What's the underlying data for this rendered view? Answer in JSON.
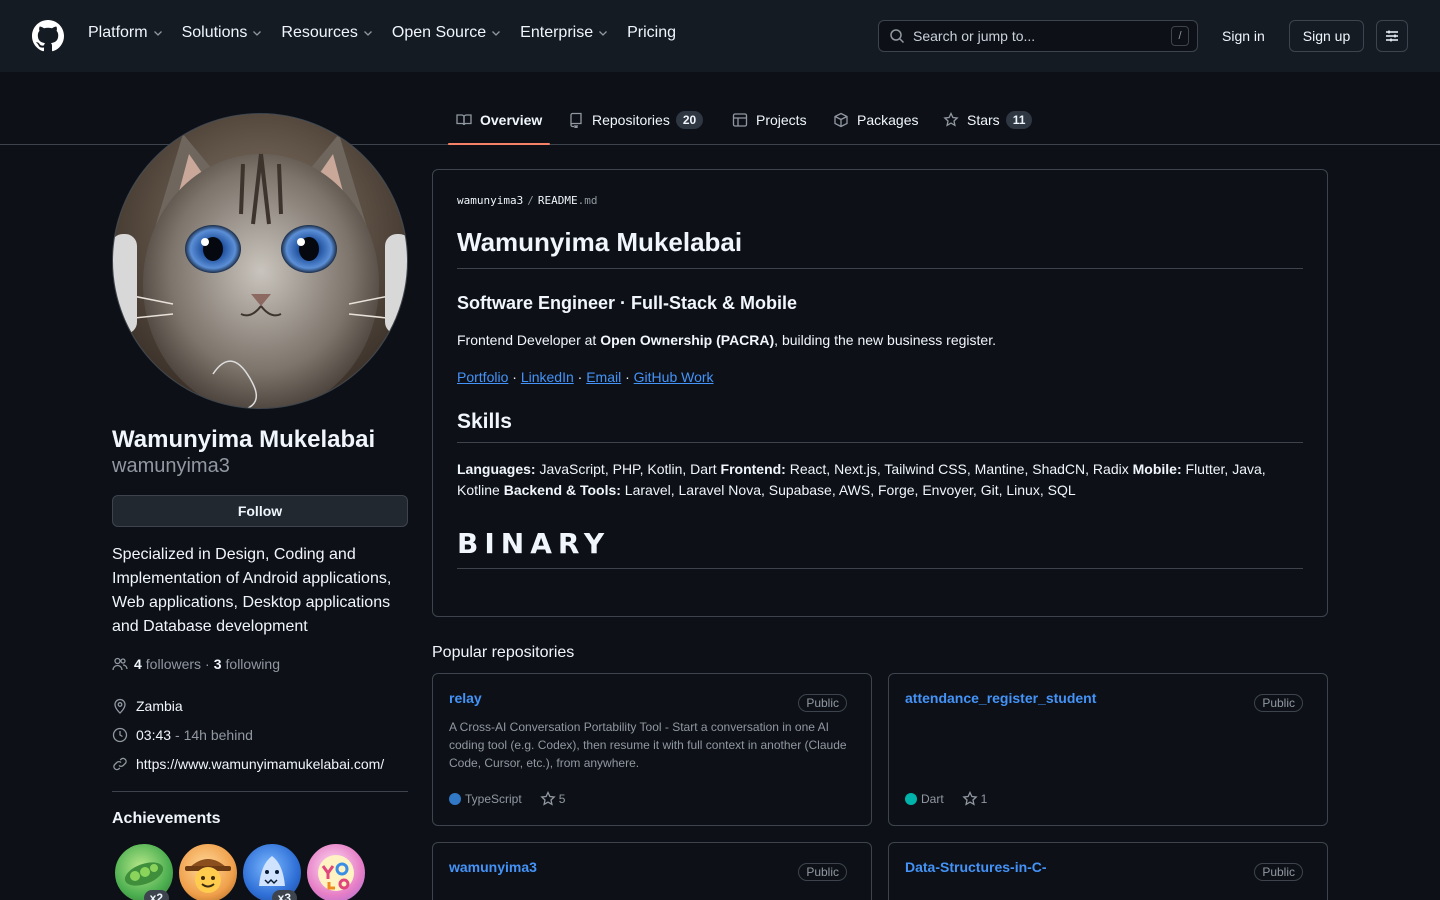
{
  "header": {
    "nav": [
      {
        "label": "Platform",
        "has_dropdown": true
      },
      {
        "label": "Solutions",
        "has_dropdown": true
      },
      {
        "label": "Resources",
        "has_dropdown": true
      },
      {
        "label": "Open Source",
        "has_dropdown": true
      },
      {
        "label": "Enterprise",
        "has_dropdown": true
      },
      {
        "label": "Pricing",
        "has_dropdown": false
      }
    ],
    "search_placeholder": "Search or jump to...",
    "search_shortcut": "/",
    "sign_in": "Sign in",
    "sign_up": "Sign up"
  },
  "tabs": [
    {
      "label": "Overview",
      "icon": "book-icon",
      "active": true
    },
    {
      "label": "Repositories",
      "icon": "repo-icon",
      "count": "20"
    },
    {
      "label": "Projects",
      "icon": "table-icon"
    },
    {
      "label": "Packages",
      "icon": "package-icon"
    },
    {
      "label": "Stars",
      "icon": "star-icon",
      "count": "11"
    }
  ],
  "profile": {
    "name": "Wamunyima Mukelabai",
    "login": "wamunyima3",
    "follow_label": "Follow",
    "bio": "Specialized in Design, Coding and Implementation of Android applications, Web applications, Desktop applications and Database development",
    "followers_count": "4",
    "followers_label": "followers",
    "separator": "·",
    "following_count": "3",
    "following_label": "following",
    "location": "Zambia",
    "local_time": "03:43",
    "time_diff": "- 14h behind",
    "website": "https://www.wamunyimamukelabai.com/",
    "achievements_title": "Achievements",
    "achievements": [
      {
        "name": "pair-extraordinaire",
        "count": "x2",
        "color": "#4caf50"
      },
      {
        "name": "yolo-cowboy",
        "count": "",
        "color": "#f0a04b"
      },
      {
        "name": "pull-shark",
        "count": "x3",
        "color": "#2f6fd6"
      },
      {
        "name": "yolo",
        "count": "",
        "color": "#e67ec6"
      }
    ]
  },
  "readme": {
    "path_user": "wamunyima3",
    "path_sep": "/",
    "path_file": "README",
    "path_ext": ".md",
    "title": "Wamunyima Mukelabai",
    "subtitle": "Software Engineer · Full-Stack & Mobile",
    "intro_prefix": "Frontend Developer at ",
    "intro_bold": "Open Ownership (PACRA)",
    "intro_suffix": ", building the new business register.",
    "links": [
      "Portfolio",
      "LinkedIn",
      "Email",
      "GitHub Work"
    ],
    "link_sep": " · ",
    "skills_title": "Skills",
    "skills": [
      {
        "label": "Languages:",
        "text": " JavaScript, PHP, Kotlin, Dart "
      },
      {
        "label": "Frontend:",
        "text": " React, Next.js, Tailwind CSS, Mantine, ShadCN, Radix "
      },
      {
        "label": "Mobile:",
        "text": " Flutter, Java, Kotline "
      },
      {
        "label": "Backend & Tools:",
        "text": " Laravel, Laravel Nova, Supabase, AWS, Forge, Envoyer, Git, Linux, SQL"
      }
    ],
    "binary": "BINARY"
  },
  "popular": {
    "title": "Popular repositories",
    "repos": [
      {
        "name": "relay",
        "visibility": "Public",
        "description": "A Cross-AI Conversation Portability Tool - Start a conversation in one AI coding tool (e.g. Codex), then resume it with full context in another (Claude Code, Cursor, etc.), from anywhere.",
        "language": "TypeScript",
        "lang_color": "#3178c6",
        "stars": "5"
      },
      {
        "name": "attendance_register_student",
        "visibility": "Public",
        "description": "",
        "language": "Dart",
        "lang_color": "#00b4ab",
        "stars": "1"
      },
      {
        "name": "wamunyima3",
        "visibility": "Public"
      },
      {
        "name": "Data-Structures-in-C-",
        "visibility": "Public"
      }
    ]
  }
}
